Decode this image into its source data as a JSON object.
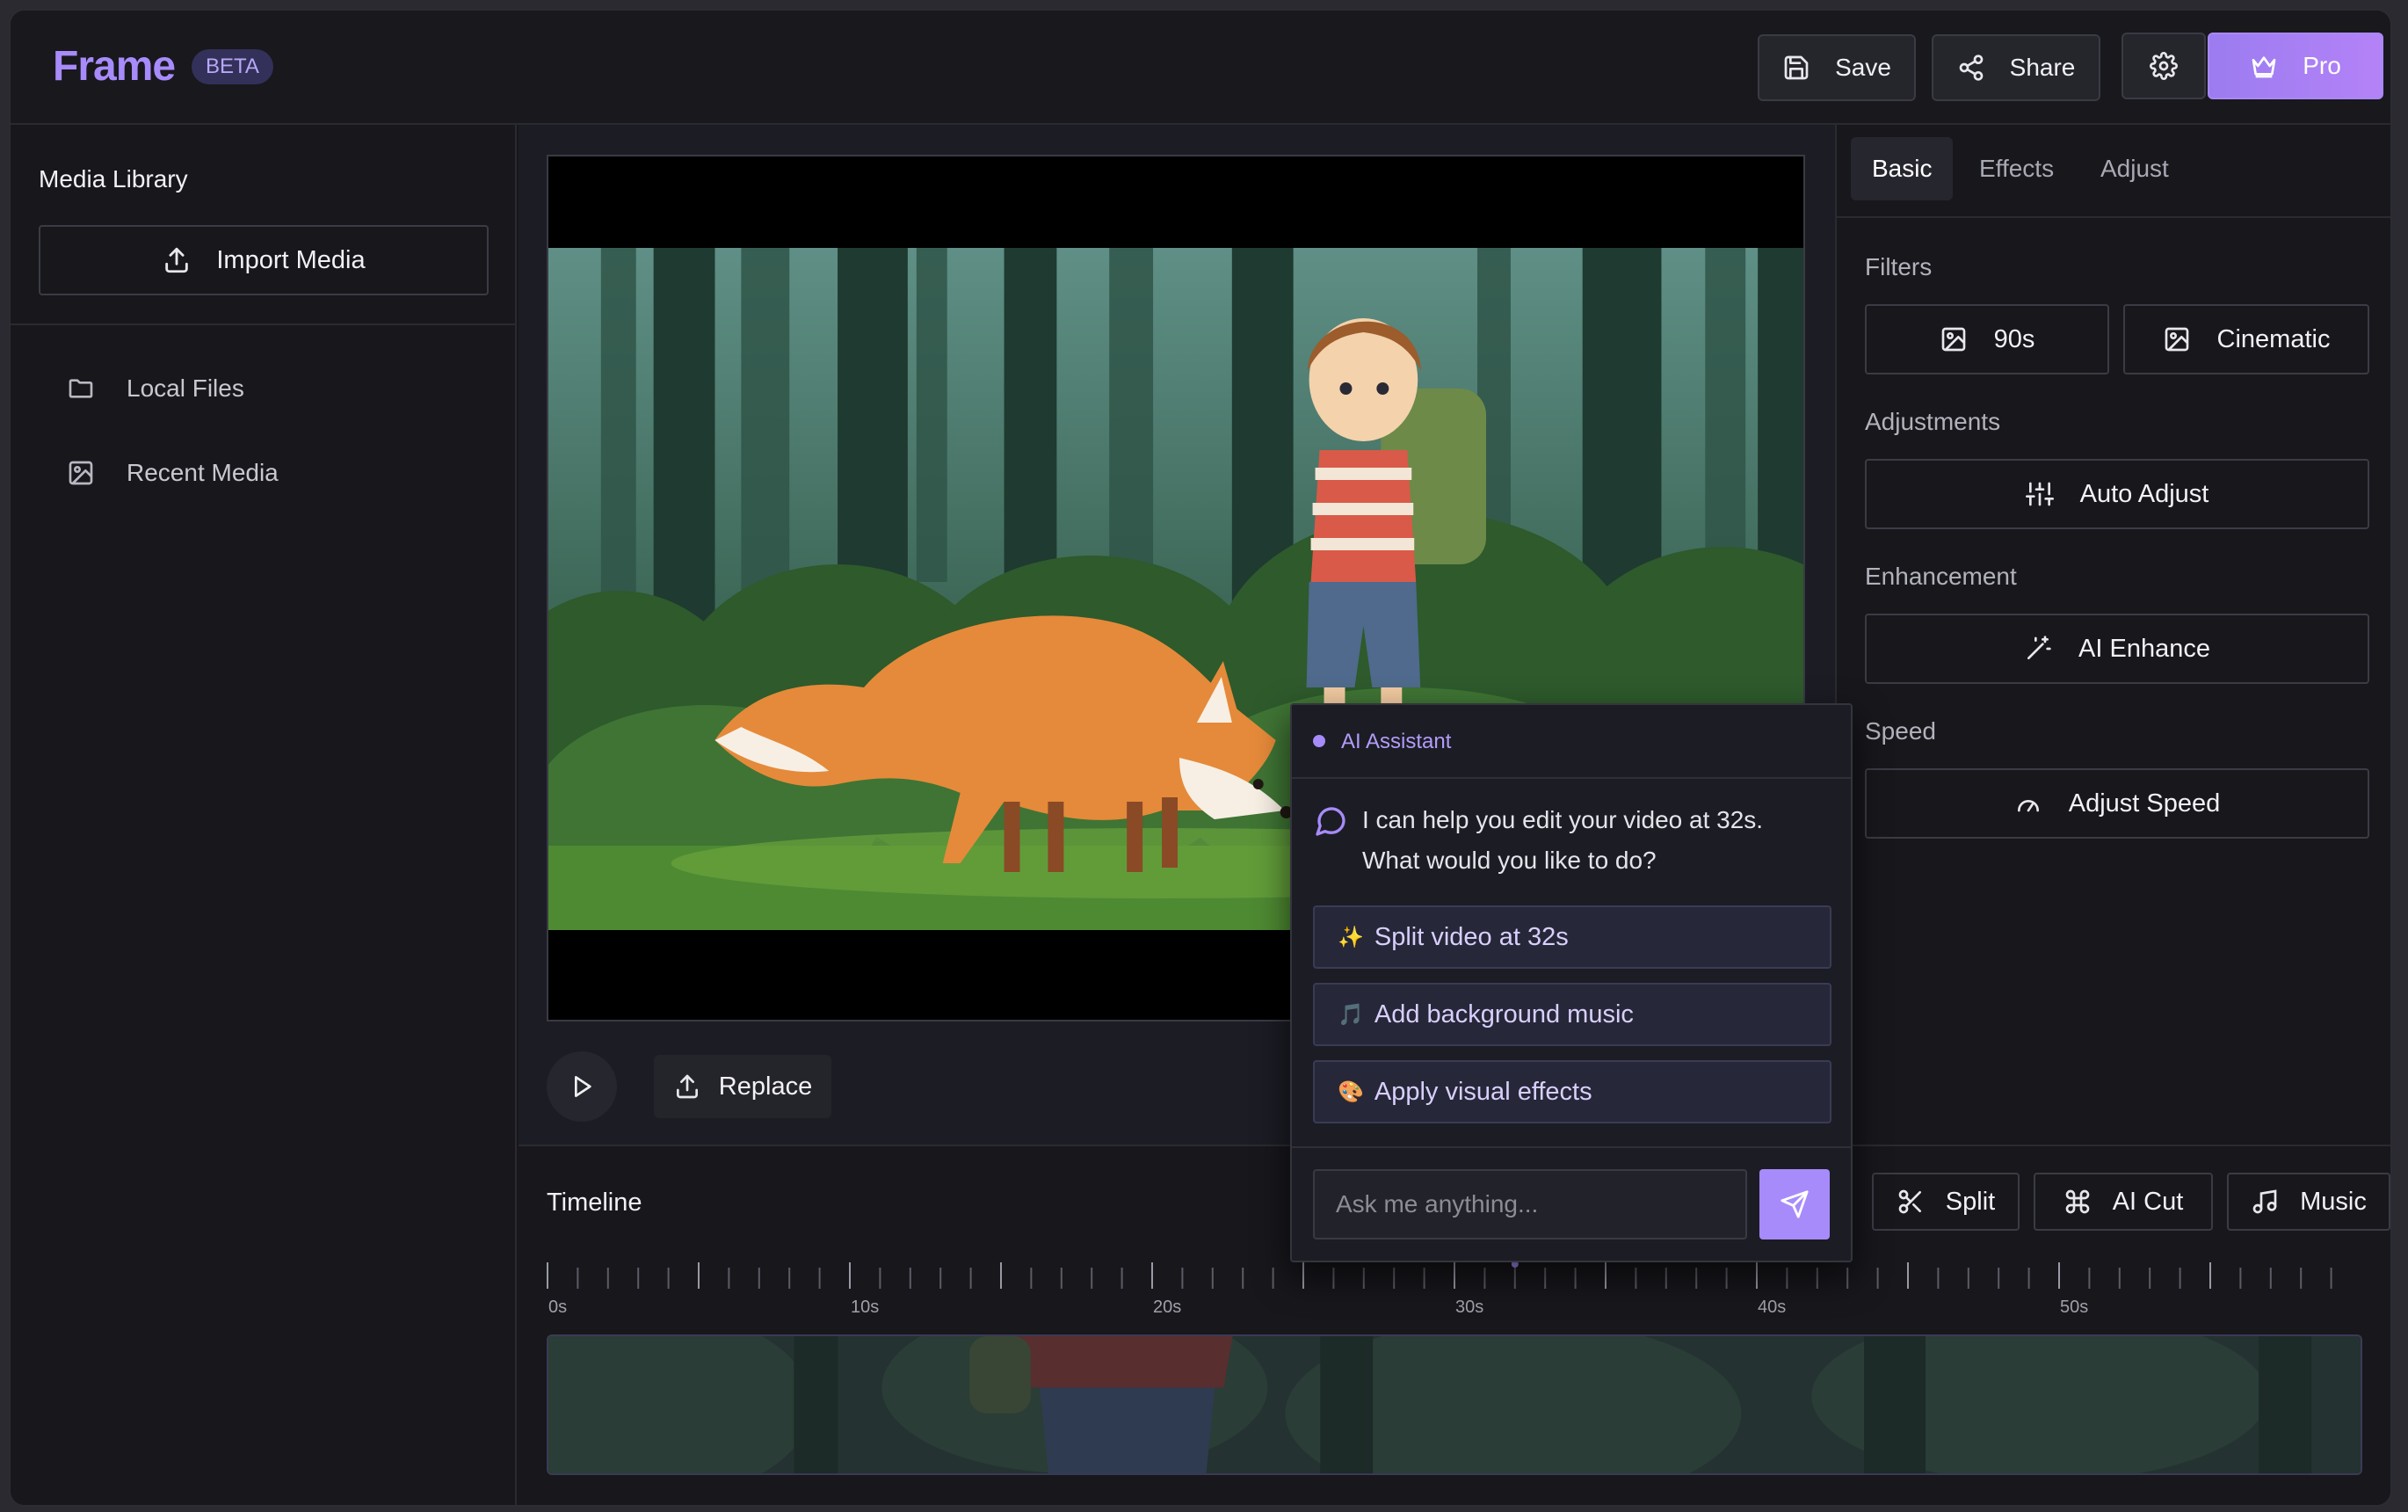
{
  "app": {
    "logo": "Frame",
    "badge": "BETA"
  },
  "header": {
    "save_label": "Save",
    "share_label": "Share",
    "pro_label": "Pro"
  },
  "sidebar": {
    "title": "Media Library",
    "import_label": "Import Media",
    "items": [
      {
        "label": "Local Files",
        "icon": "folder-icon"
      },
      {
        "label": "Recent Media",
        "icon": "image-icon"
      }
    ]
  },
  "player": {
    "replace_label": "Replace"
  },
  "panel": {
    "tabs": [
      "Basic",
      "Effects",
      "Adjust"
    ],
    "filters_label": "Filters",
    "filters": [
      "90s",
      "Cinematic"
    ],
    "adjustments_label": "Adjustments",
    "auto_adjust_label": "Auto Adjust",
    "enhancement_label": "Enhancement",
    "ai_enhance_label": "AI Enhance",
    "speed_label": "Speed",
    "adjust_speed_label": "Adjust Speed"
  },
  "timeline": {
    "title": "Timeline",
    "split_label": "Split",
    "ai_cut_label": "AI Cut",
    "music_label": "Music",
    "tick_labels": [
      "0s",
      "10s",
      "20s",
      "30s",
      "40s",
      "50s"
    ],
    "playhead_seconds": 32
  },
  "ai_assistant": {
    "title": "AI Assistant",
    "message": "I can help you edit your video at 32s. What would you like to do?",
    "options": [
      {
        "emoji": "✨",
        "label": "Split video at 32s"
      },
      {
        "emoji": "🎵",
        "label": "Add background music"
      },
      {
        "emoji": "🎨",
        "label": "Apply visual effects"
      }
    ],
    "input_placeholder": "Ask me anything..."
  },
  "colors": {
    "accent": "#a78bfa",
    "background": "#17171c"
  }
}
